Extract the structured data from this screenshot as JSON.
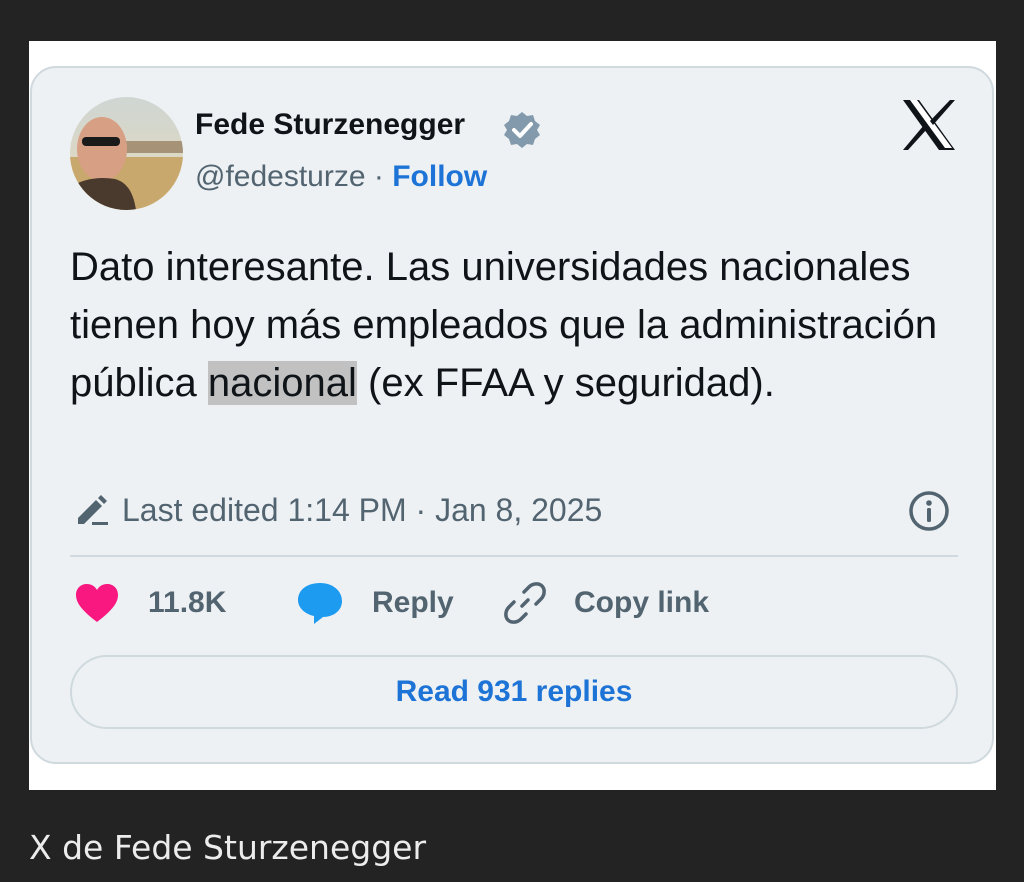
{
  "tweet": {
    "author_name": "Fede Sturzenegger",
    "handle": "@fedesturze",
    "separator": " · ",
    "follow_label": "Follow",
    "text_before": "Dato interesante. Las universidades nacionales tienen hoy más empleados que la administración pública ",
    "text_highlight": "nacional",
    "text_after": " (ex FFAA y seguridad).",
    "edited_label": "Last edited 1:14 PM · Jan 8, 2025",
    "likes": "11.8K",
    "reply_label": "Reply",
    "copy_link_label": "Copy link",
    "read_replies_label": "Read 931 replies"
  },
  "caption": "X de Fede Sturzenegger",
  "colors": {
    "accent": "#1d74d6",
    "like": "#f91880",
    "reply": "#1d9bf0",
    "muted": "#536471"
  },
  "icons": {
    "verified": "verified-badge-icon",
    "brand": "x-logo-icon",
    "edit": "pencil-icon",
    "info": "info-icon",
    "like": "heart-icon",
    "reply": "speech-bubble-icon",
    "copy": "link-icon"
  }
}
